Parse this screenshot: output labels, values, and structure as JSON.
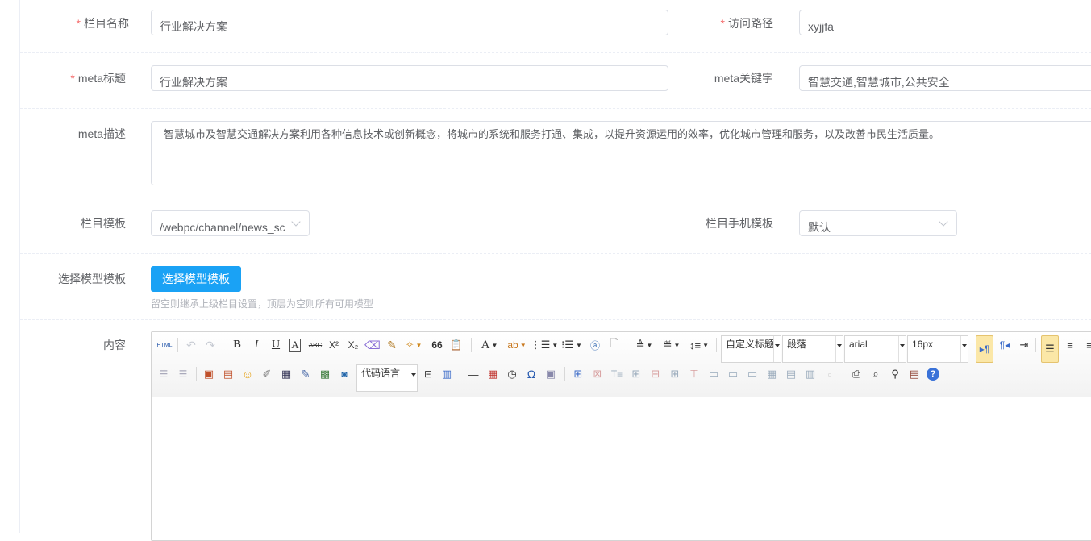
{
  "form": {
    "required_mark": "*",
    "column_name": {
      "label": "栏目名称",
      "value": "行业解决方案"
    },
    "access_path": {
      "label": "访问路径",
      "value": "xyjjfa"
    },
    "meta_title": {
      "label": "meta标题",
      "value": "行业解决方案"
    },
    "meta_keywords": {
      "label": "meta关键字",
      "value": "智慧交通,智慧城市,公共安全"
    },
    "meta_description": {
      "label": "meta描述",
      "value": "智慧城市及智慧交通解决方案利用各种信息技术或创新概念，将城市的系统和服务打通、集成，以提升资源运用的效率，优化城市管理和服务，以及改善市民生活质量。"
    },
    "column_template": {
      "label": "栏目模板",
      "value": "/webpc/channel/news_sc"
    },
    "mobile_template": {
      "label": "栏目手机模板",
      "value": "默认"
    },
    "model_template": {
      "label": "选择模型模板",
      "button": "选择模型模板",
      "hint": "留空则继承上级栏目设置，顶层为空则所有可用模型"
    },
    "content": {
      "label": "内容"
    }
  },
  "editor": {
    "html_label": "HTML",
    "format_combo": "自定义标题",
    "paragraph_combo": "段落",
    "font_combo": "arial",
    "size_combo": "16px",
    "code_combo": "代码语言",
    "text_icons": {
      "bold": "B",
      "italic": "I",
      "underline": "U",
      "boxA": "A",
      "strike": "ABC",
      "sup": "X²",
      "sub": "X₂",
      "quote": "66",
      "fontcolor": "A",
      "hr": "—",
      "omega": "Ω",
      "help": "?"
    }
  },
  "colors": {
    "primary": "#1aa2f5",
    "required": "#f56c6c",
    "active_bg": "#fbe7a7"
  }
}
